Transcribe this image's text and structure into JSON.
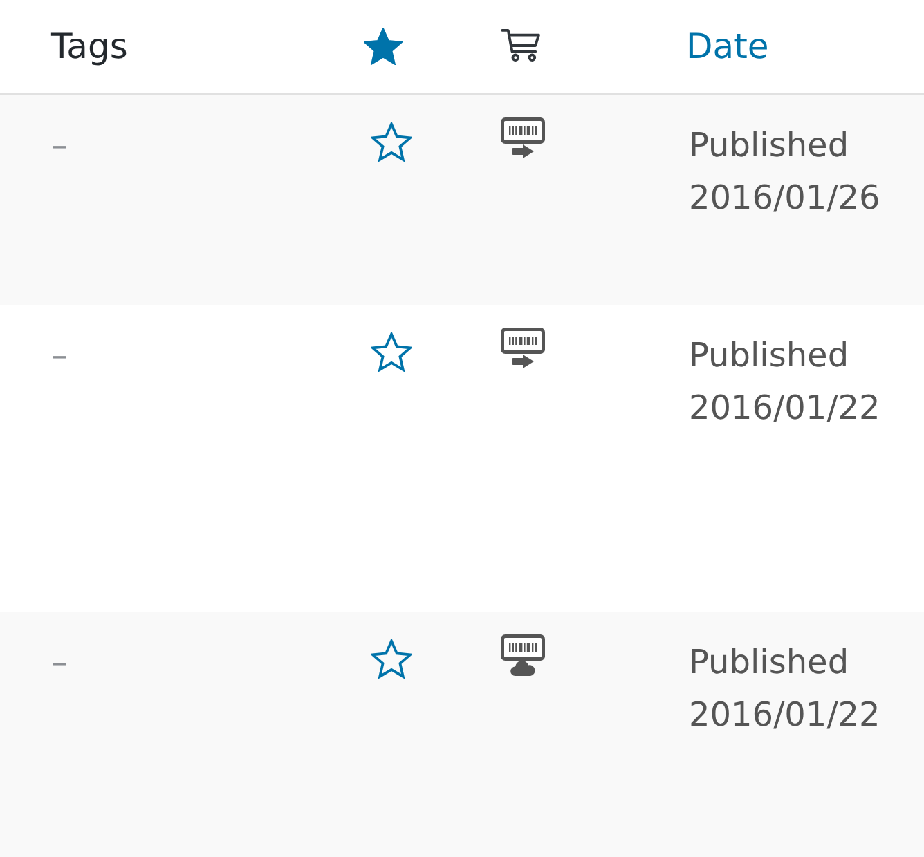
{
  "table": {
    "columns": [
      {
        "kind": "text",
        "label": "Tags"
      },
      {
        "kind": "featured"
      },
      {
        "kind": "product_type"
      },
      {
        "kind": "link",
        "label": "Date"
      }
    ],
    "rows": [
      {
        "tags": "–",
        "featured": false,
        "kind": "arrow",
        "status": "Published",
        "date": "2016/01/26"
      },
      {
        "tags": "–",
        "featured": false,
        "kind": "arrow",
        "status": "Published",
        "date": "2016/01/22"
      },
      {
        "tags": "–",
        "featured": false,
        "kind": "cloud",
        "status": "Published",
        "date": "2016/01/22"
      }
    ]
  }
}
